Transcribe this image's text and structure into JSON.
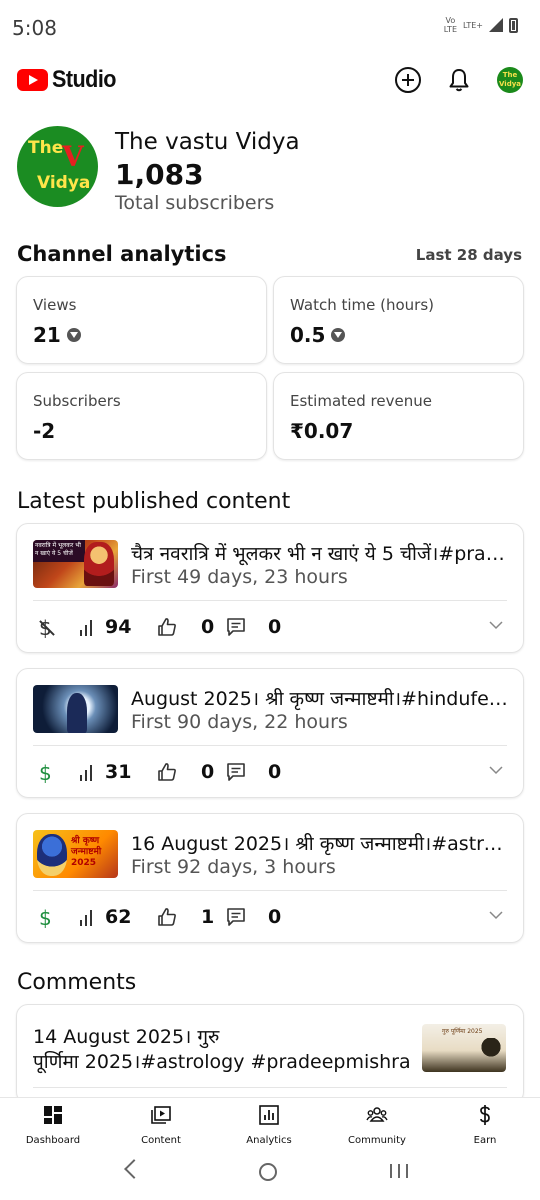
{
  "status_bar": {
    "time": "5:08",
    "network_top": "Vo",
    "network_mid": "LTE",
    "network_2": "LTE+"
  },
  "header": {
    "app_name": "Studio",
    "brand_color": "#ff0000"
  },
  "channel": {
    "name": "The vastu Vidya",
    "subscriber_count": "1,083",
    "subscriber_label": "Total subscribers",
    "avatar_text_1": "The",
    "avatar_text_2": "V",
    "avatar_text_3": "Vidya",
    "avatar_small_1": "The",
    "avatar_small_2": "Vidya"
  },
  "analytics": {
    "title": "Channel analytics",
    "period": "Last 28 days",
    "cards": [
      {
        "label": "Views",
        "value": "21",
        "trend": "down"
      },
      {
        "label": "Watch time (hours)",
        "value": "0.5",
        "trend": "down"
      },
      {
        "label": "Subscribers",
        "value": "-2"
      },
      {
        "label": "Estimated revenue",
        "value": "₹0.07"
      }
    ]
  },
  "latest": {
    "title": "Latest published content",
    "videos": [
      {
        "title": "चैत्र नवरात्रि में भूलकर भी न खाएं ये 5 चीजें।#pradeepmishra",
        "age": "First 49 days, 23 hours",
        "monetized": false,
        "views": "94",
        "likes": "0",
        "comments": "0",
        "thumb_text": "नवरात्रि में भूलकर भी न खाएं ये 5 चीजें"
      },
      {
        "title": " August 2025। श्री कृष्ण जन्माष्टमी।#hindufestival",
        "age": "First 90 days, 22 hours",
        "monetized": true,
        "views": "31",
        "likes": "0",
        "comments": "0"
      },
      {
        "title": "16 August 2025। श्री कृष्ण जन्माष्टमी।#astrology",
        "age": "First 92 days, 3 hours",
        "monetized": true,
        "views": "62",
        "likes": "1",
        "comments": "0",
        "thumb_text_1": "श्री कृष्ण",
        "thumb_text_2": "जन्माष्टमी",
        "thumb_text_3": "2025"
      }
    ]
  },
  "comments": {
    "title": "Comments",
    "item_title_1": "14 August 2025। गुरु",
    "item_title_2": "पूर्णिमा 2025।#astrology #pradeepmishra",
    "thumb_text": "गुरु पूर्णिमा 2025"
  },
  "bottom_nav": [
    {
      "label": "Dashboard",
      "icon": "dashboard-icon"
    },
    {
      "label": "Content",
      "icon": "content-icon"
    },
    {
      "label": "Analytics",
      "icon": "analytics-icon"
    },
    {
      "label": "Community",
      "icon": "community-icon"
    },
    {
      "label": "Earn",
      "icon": "earn-icon"
    }
  ]
}
